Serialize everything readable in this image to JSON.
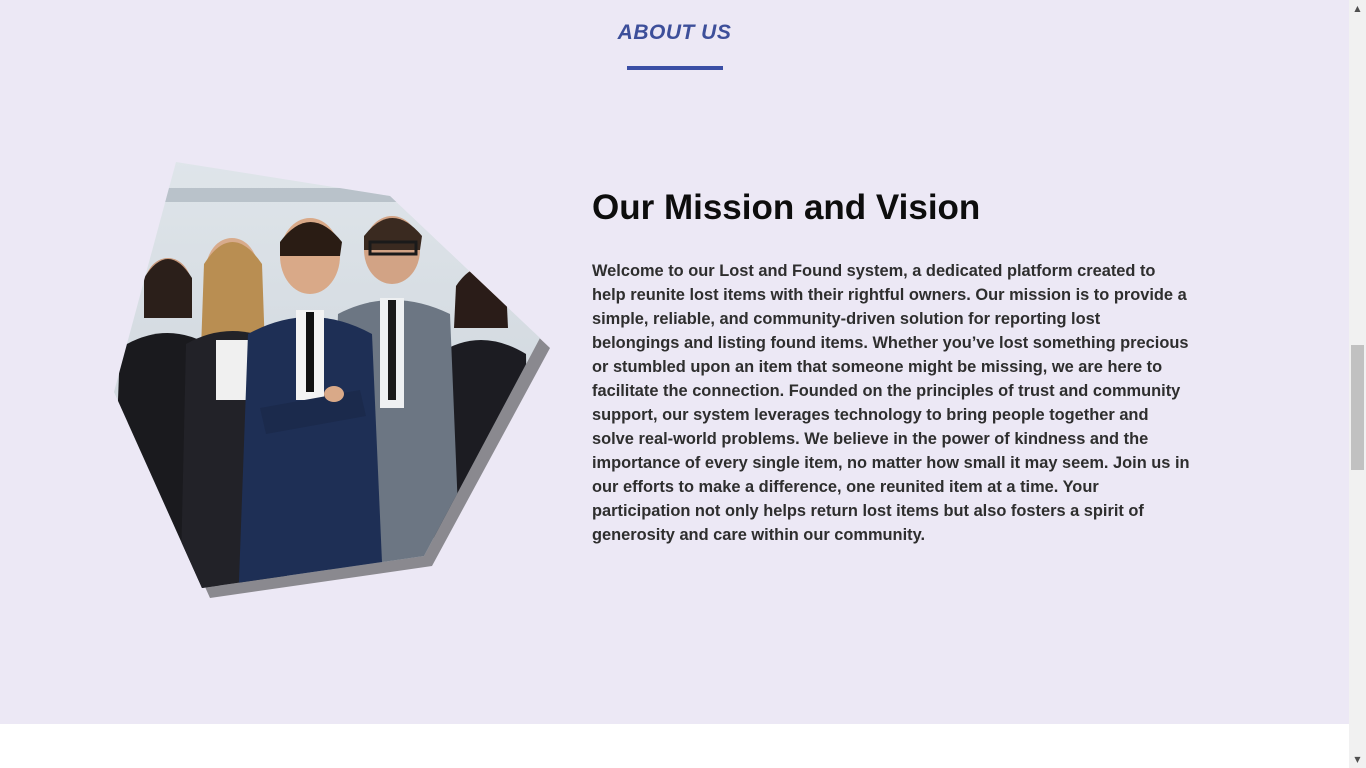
{
  "about": {
    "heading": "ABOUT US",
    "mission_title": "Our Mission and Vision",
    "mission_text": "Welcome to our Lost and Found system, a dedicated platform created to help reunite lost items with their rightful owners. Our mission is to provide a simple, reliable, and community-driven solution for reporting lost belongings and listing found items. Whether you’ve lost something precious or stumbled upon an item that someone might be missing, we are here to facilitate the connection. Founded on the principles of trust and community support, our system leverages technology to bring people together and solve real-world problems. We believe in the power of kindness and the importance of every single item, no matter how small it may seem. Join us in our efforts to make a difference, one reunited item at a time. Your participation not only helps return lost items but also fosters a spirit of generosity and care within our community."
  },
  "scrollbar": {
    "up_icon": "triangle-up-icon",
    "down_icon": "triangle-down-icon"
  },
  "colors": {
    "section_bg": "#ece8f5",
    "heading": "#3d4f9a",
    "underline": "#3a4ea5",
    "title": "#0d0d0d",
    "body_text": "#2e2e2e"
  }
}
